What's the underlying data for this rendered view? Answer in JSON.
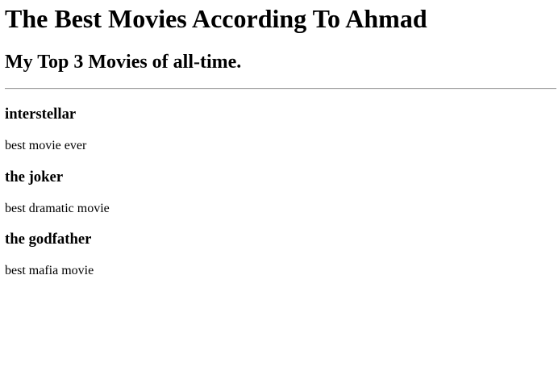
{
  "page": {
    "title": "The Best Movies According To Ahmad",
    "subtitle": "My Top 3 Movies of all-time."
  },
  "movies": [
    {
      "title": "interstellar",
      "description": "best movie ever"
    },
    {
      "title": "the joker",
      "description": "best dramatic movie"
    },
    {
      "title": "the godfather",
      "description": "best mafia movie"
    }
  ]
}
